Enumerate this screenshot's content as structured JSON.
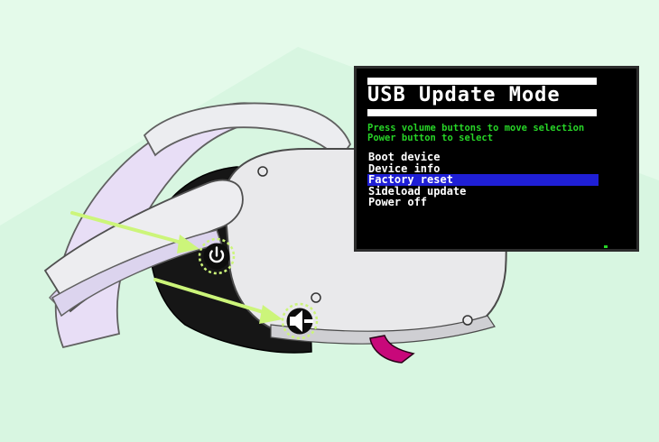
{
  "usb_update_screen": {
    "title": "USB Update Mode",
    "instructions": [
      "Press volume buttons to move selection",
      "Power button to select"
    ],
    "menu_items": [
      {
        "label": "Boot device",
        "selected": false
      },
      {
        "label": "Device info",
        "selected": false
      },
      {
        "label": "Factory reset",
        "selected": true
      },
      {
        "label": "Sideload update",
        "selected": false
      },
      {
        "label": "Power off",
        "selected": false
      }
    ]
  },
  "headset_buttons": [
    {
      "icon": "power-icon",
      "role": "power button"
    },
    {
      "icon": "volume-down-icon",
      "role": "volume button"
    }
  ],
  "colors": {
    "background": "#e4faea",
    "arrow": "#ccf57a",
    "menu_text": "#ffffff",
    "instruction_text": "#27d427",
    "selection_highlight": "#1f1fd6",
    "strap": "#eee8f8",
    "visor": "#e9e9eb",
    "accent_magenta": "#c8087a"
  }
}
